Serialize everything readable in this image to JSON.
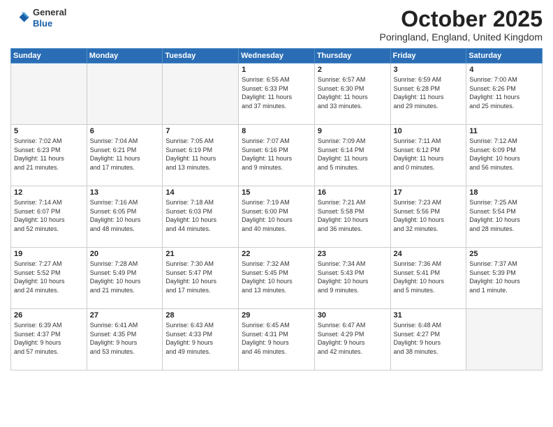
{
  "header": {
    "logo_general": "General",
    "logo_blue": "Blue",
    "month": "October 2025",
    "location": "Poringland, England, United Kingdom"
  },
  "days_of_week": [
    "Sunday",
    "Monday",
    "Tuesday",
    "Wednesday",
    "Thursday",
    "Friday",
    "Saturday"
  ],
  "weeks": [
    [
      {
        "day": "",
        "info": ""
      },
      {
        "day": "",
        "info": ""
      },
      {
        "day": "",
        "info": ""
      },
      {
        "day": "1",
        "info": "Sunrise: 6:55 AM\nSunset: 6:33 PM\nDaylight: 11 hours\nand 37 minutes."
      },
      {
        "day": "2",
        "info": "Sunrise: 6:57 AM\nSunset: 6:30 PM\nDaylight: 11 hours\nand 33 minutes."
      },
      {
        "day": "3",
        "info": "Sunrise: 6:59 AM\nSunset: 6:28 PM\nDaylight: 11 hours\nand 29 minutes."
      },
      {
        "day": "4",
        "info": "Sunrise: 7:00 AM\nSunset: 6:26 PM\nDaylight: 11 hours\nand 25 minutes."
      }
    ],
    [
      {
        "day": "5",
        "info": "Sunrise: 7:02 AM\nSunset: 6:23 PM\nDaylight: 11 hours\nand 21 minutes."
      },
      {
        "day": "6",
        "info": "Sunrise: 7:04 AM\nSunset: 6:21 PM\nDaylight: 11 hours\nand 17 minutes."
      },
      {
        "day": "7",
        "info": "Sunrise: 7:05 AM\nSunset: 6:19 PM\nDaylight: 11 hours\nand 13 minutes."
      },
      {
        "day": "8",
        "info": "Sunrise: 7:07 AM\nSunset: 6:16 PM\nDaylight: 11 hours\nand 9 minutes."
      },
      {
        "day": "9",
        "info": "Sunrise: 7:09 AM\nSunset: 6:14 PM\nDaylight: 11 hours\nand 5 minutes."
      },
      {
        "day": "10",
        "info": "Sunrise: 7:11 AM\nSunset: 6:12 PM\nDaylight: 11 hours\nand 0 minutes."
      },
      {
        "day": "11",
        "info": "Sunrise: 7:12 AM\nSunset: 6:09 PM\nDaylight: 10 hours\nand 56 minutes."
      }
    ],
    [
      {
        "day": "12",
        "info": "Sunrise: 7:14 AM\nSunset: 6:07 PM\nDaylight: 10 hours\nand 52 minutes."
      },
      {
        "day": "13",
        "info": "Sunrise: 7:16 AM\nSunset: 6:05 PM\nDaylight: 10 hours\nand 48 minutes."
      },
      {
        "day": "14",
        "info": "Sunrise: 7:18 AM\nSunset: 6:03 PM\nDaylight: 10 hours\nand 44 minutes."
      },
      {
        "day": "15",
        "info": "Sunrise: 7:19 AM\nSunset: 6:00 PM\nDaylight: 10 hours\nand 40 minutes."
      },
      {
        "day": "16",
        "info": "Sunrise: 7:21 AM\nSunset: 5:58 PM\nDaylight: 10 hours\nand 36 minutes."
      },
      {
        "day": "17",
        "info": "Sunrise: 7:23 AM\nSunset: 5:56 PM\nDaylight: 10 hours\nand 32 minutes."
      },
      {
        "day": "18",
        "info": "Sunrise: 7:25 AM\nSunset: 5:54 PM\nDaylight: 10 hours\nand 28 minutes."
      }
    ],
    [
      {
        "day": "19",
        "info": "Sunrise: 7:27 AM\nSunset: 5:52 PM\nDaylight: 10 hours\nand 24 minutes."
      },
      {
        "day": "20",
        "info": "Sunrise: 7:28 AM\nSunset: 5:49 PM\nDaylight: 10 hours\nand 21 minutes."
      },
      {
        "day": "21",
        "info": "Sunrise: 7:30 AM\nSunset: 5:47 PM\nDaylight: 10 hours\nand 17 minutes."
      },
      {
        "day": "22",
        "info": "Sunrise: 7:32 AM\nSunset: 5:45 PM\nDaylight: 10 hours\nand 13 minutes."
      },
      {
        "day": "23",
        "info": "Sunrise: 7:34 AM\nSunset: 5:43 PM\nDaylight: 10 hours\nand 9 minutes."
      },
      {
        "day": "24",
        "info": "Sunrise: 7:36 AM\nSunset: 5:41 PM\nDaylight: 10 hours\nand 5 minutes."
      },
      {
        "day": "25",
        "info": "Sunrise: 7:37 AM\nSunset: 5:39 PM\nDaylight: 10 hours\nand 1 minute."
      }
    ],
    [
      {
        "day": "26",
        "info": "Sunrise: 6:39 AM\nSunset: 4:37 PM\nDaylight: 9 hours\nand 57 minutes."
      },
      {
        "day": "27",
        "info": "Sunrise: 6:41 AM\nSunset: 4:35 PM\nDaylight: 9 hours\nand 53 minutes."
      },
      {
        "day": "28",
        "info": "Sunrise: 6:43 AM\nSunset: 4:33 PM\nDaylight: 9 hours\nand 49 minutes."
      },
      {
        "day": "29",
        "info": "Sunrise: 6:45 AM\nSunset: 4:31 PM\nDaylight: 9 hours\nand 46 minutes."
      },
      {
        "day": "30",
        "info": "Sunrise: 6:47 AM\nSunset: 4:29 PM\nDaylight: 9 hours\nand 42 minutes."
      },
      {
        "day": "31",
        "info": "Sunrise: 6:48 AM\nSunset: 4:27 PM\nDaylight: 9 hours\nand 38 minutes."
      },
      {
        "day": "",
        "info": ""
      }
    ]
  ]
}
